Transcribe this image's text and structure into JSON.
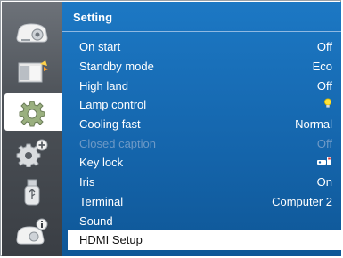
{
  "menu": {
    "title": "Setting",
    "items": [
      {
        "label": "On start",
        "value": "Off"
      },
      {
        "label": "Standby mode",
        "value": "Eco"
      },
      {
        "label": "High land",
        "value": "Off"
      },
      {
        "label": "Lamp control",
        "value": "",
        "value_icon": "lamp-bulb-icon"
      },
      {
        "label": "Cooling fast",
        "value": "Normal"
      },
      {
        "label": "Closed caption",
        "value": "Off",
        "disabled": true
      },
      {
        "label": "Key lock",
        "value": "",
        "value_icon": "key-lock-icon"
      },
      {
        "label": "Iris",
        "value": "On"
      },
      {
        "label": "Terminal",
        "value": "Computer 2"
      },
      {
        "label": "Sound",
        "value": ""
      },
      {
        "label": "HDMI Setup",
        "value": "",
        "selected": true
      }
    ]
  },
  "sidebar": {
    "items": [
      {
        "icon": "projector-icon"
      },
      {
        "icon": "image-adjust-icon"
      },
      {
        "icon": "setting-gear-icon",
        "active": true
      },
      {
        "icon": "expanded-gear-icon"
      },
      {
        "icon": "usb-icon"
      },
      {
        "icon": "projector-info-icon"
      }
    ]
  },
  "colors": {
    "panel": "#1566ad",
    "sidebar": "#4c5157",
    "disabled_text": "#6d99c6",
    "lamp_icon": "#ffe23a"
  }
}
